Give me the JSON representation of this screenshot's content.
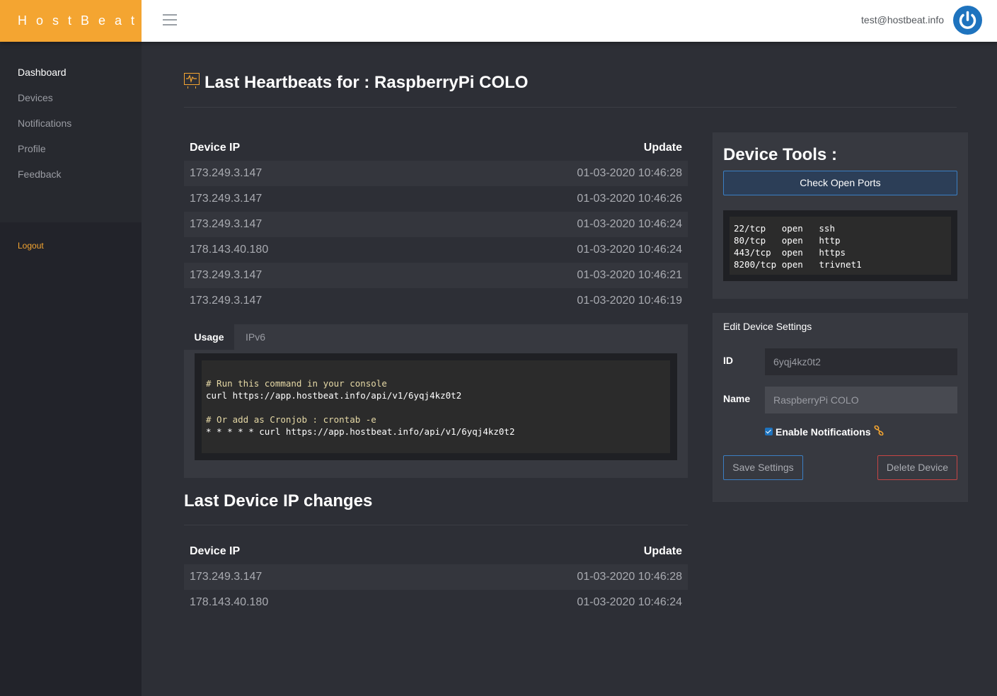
{
  "brand": "HostBeat",
  "header": {
    "user_email": "test@hostbeat.info"
  },
  "sidebar": {
    "items": [
      {
        "label": "Dashboard"
      },
      {
        "label": "Devices"
      },
      {
        "label": "Notifications"
      },
      {
        "label": "Profile"
      },
      {
        "label": "Feedback"
      }
    ],
    "logout": "Logout"
  },
  "page": {
    "title": "Last Heartbeats for : RaspberryPi COLO"
  },
  "heartbeats": {
    "headers": {
      "ip": "Device IP",
      "update": "Update"
    },
    "rows": [
      {
        "ip": "173.249.3.147",
        "update": "01-03-2020 10:46:28"
      },
      {
        "ip": "173.249.3.147",
        "update": "01-03-2020 10:46:26"
      },
      {
        "ip": "173.249.3.147",
        "update": "01-03-2020 10:46:24"
      },
      {
        "ip": "178.143.40.180",
        "update": "01-03-2020 10:46:24"
      },
      {
        "ip": "173.249.3.147",
        "update": "01-03-2020 10:46:21"
      },
      {
        "ip": "173.249.3.147",
        "update": "01-03-2020 10:46:19"
      }
    ]
  },
  "tabs": {
    "usage": "Usage",
    "ipv6": "IPv6",
    "code": [
      {
        "text": "# Run this command in your console",
        "comment": true
      },
      {
        "text": "curl https://app.hostbeat.info/api/v1/6yqj4kz0t2",
        "comment": false
      },
      {
        "text": "",
        "comment": false
      },
      {
        "text": "# Or add as Cronjob : crontab -e",
        "comment": true
      },
      {
        "text": "* * * * * curl https://app.hostbeat.info/api/v1/6yqj4kz0t2",
        "comment": false
      }
    ]
  },
  "ip_changes": {
    "title": "Last Device IP changes",
    "headers": {
      "ip": "Device IP",
      "update": "Update"
    },
    "rows": [
      {
        "ip": "173.249.3.147",
        "update": "01-03-2020 10:46:28"
      },
      {
        "ip": "178.143.40.180",
        "update": "01-03-2020 10:46:24"
      }
    ]
  },
  "tools": {
    "title": "Device Tools :",
    "check_ports": "Check Open Ports",
    "ports": [
      "22/tcp   open   ssh",
      "80/tcp   open   http",
      "443/tcp  open   https",
      "8200/tcp open   trivnet1"
    ]
  },
  "settings": {
    "title": "Edit Device Settings",
    "id_label": "ID",
    "id_value": "6yqj4kz0t2",
    "name_label": "Name",
    "name_value": "RaspberryPi COLO",
    "notifications_label": "Enable Notifications",
    "notifications_checked": true,
    "save": "Save Settings",
    "delete": "Delete Device"
  },
  "colors": {
    "brand": "#f4a531",
    "primary": "#1e73be",
    "danger": "#c64545",
    "background": "#2d2f36"
  }
}
